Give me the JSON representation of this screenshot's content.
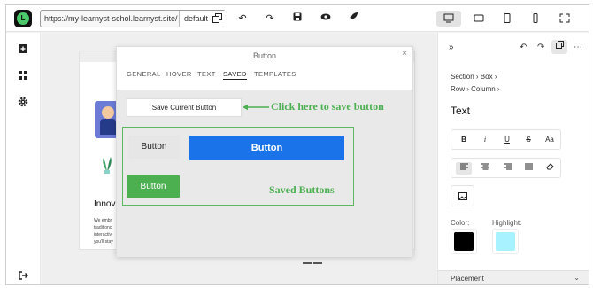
{
  "topbar": {
    "url": "https://my-learnyst-schol.learnyst.site/",
    "environment": "default",
    "logo_letter": "L"
  },
  "dialog": {
    "title": "Button",
    "tabs": [
      {
        "label": "GENERAL",
        "active": false
      },
      {
        "label": "HOVER",
        "active": false
      },
      {
        "label": "TEXT",
        "active": false
      },
      {
        "label": "SAVED",
        "active": true
      },
      {
        "label": "TEMPLATES",
        "active": false
      }
    ],
    "save_current_label": "Save Current Button",
    "save_hint": "Click here to save button",
    "saved_buttons_label": "Saved Buttons",
    "saved_buttons": [
      {
        "label": "Button",
        "style": "gray",
        "color": "#e6e6e6"
      },
      {
        "label": "Button",
        "style": "blue",
        "color": "#1a73e8"
      },
      {
        "label": "Button",
        "style": "green",
        "color": "#4caf50"
      }
    ]
  },
  "page_preview": {
    "heading": "Innov",
    "text_lines": [
      "We embr",
      "traditionc",
      "interactiv",
      "you'll stay"
    ]
  },
  "sidebar": {
    "breadcrumb_line1": [
      "Section",
      "Box"
    ],
    "breadcrumb_line2": [
      "Row",
      "Column"
    ],
    "panel_title": "Text",
    "format_buttons": [
      "B",
      "i",
      "U",
      "S",
      "Aa"
    ],
    "color_label": "Color:",
    "highlight_label": "Highlight:",
    "color_value": "#000000",
    "highlight_value": "#a8f2ff",
    "placement_label": "Placement"
  },
  "colors": {
    "accent_green": "#4caf50",
    "primary_blue": "#1a73e8"
  }
}
